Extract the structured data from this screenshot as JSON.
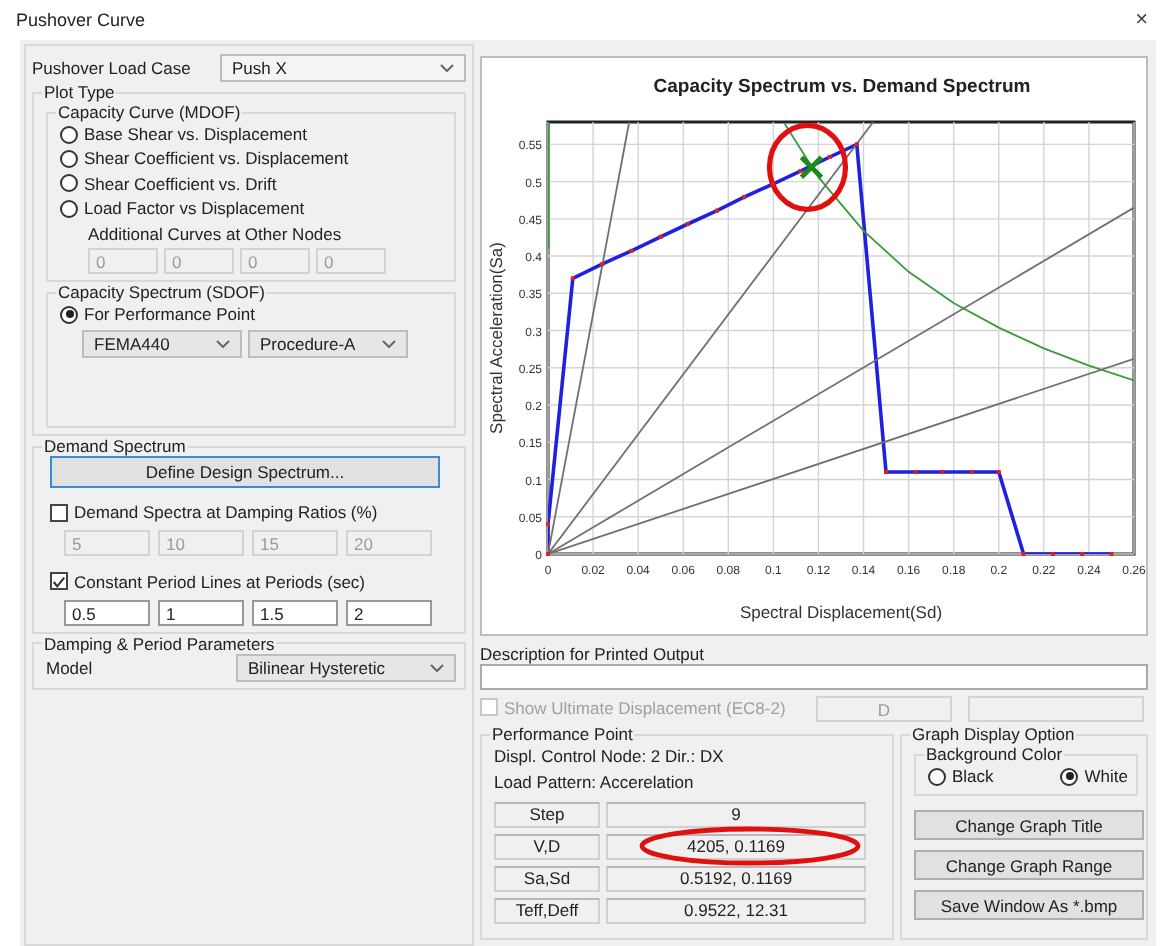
{
  "window": {
    "title": "Pushover Curve",
    "close": "×"
  },
  "load_case": {
    "label": "Pushover Load Case",
    "value": "Push X"
  },
  "plot_type": {
    "title": "Plot Type",
    "capacity_curve": {
      "title": "Capacity Curve (MDOF)",
      "options": [
        {
          "label": "Base Shear vs. Displacement",
          "selected": false
        },
        {
          "label": "Shear Coefficient vs. Displacement",
          "selected": false
        },
        {
          "label": "Shear Coefficient vs. Drift",
          "selected": false
        },
        {
          "label": "Load Factor vs Displacement",
          "selected": false
        }
      ],
      "additional_label": "Additional Curves at Other Nodes",
      "additional_fields": [
        {
          "value": "0",
          "disabled": true
        },
        {
          "value": "0",
          "disabled": true
        },
        {
          "value": "0",
          "disabled": true
        },
        {
          "value": "0",
          "disabled": true
        }
      ]
    },
    "capacity_spectrum": {
      "title": "Capacity Spectrum (SDOF)",
      "options": [
        {
          "label": "For Performance Point",
          "selected": true
        }
      ],
      "method": "FEMA440",
      "procedure": "Procedure-A"
    }
  },
  "demand_spectrum": {
    "title": "Demand Spectrum",
    "button": "Define Design Spectrum...",
    "damping": {
      "label": "Demand Spectra at Damping Ratios (%)",
      "checked": false,
      "fields": [
        {
          "value": "5",
          "disabled": true
        },
        {
          "value": "10",
          "disabled": true
        },
        {
          "value": "15",
          "disabled": true
        },
        {
          "value": "20",
          "disabled": true
        }
      ]
    },
    "periods": {
      "label": "Constant Period Lines at Periods (sec)",
      "checked": true,
      "fields": [
        {
          "value": "0.5",
          "disabled": false
        },
        {
          "value": "1",
          "disabled": false
        },
        {
          "value": "1.5",
          "disabled": false
        },
        {
          "value": "2",
          "disabled": false
        }
      ]
    }
  },
  "damping_parameters": {
    "title": "Damping & Period Parameters",
    "model_label": "Model",
    "model": "Bilinear Hysteretic"
  },
  "chart": {
    "circled": true,
    "chart_data": {
      "type": "line",
      "title": "Capacity Spectrum vs. Demand Spectrum",
      "xlabel": "Spectral Displacement(Sd)",
      "ylabel": "Spectral Acceleration(Sa)",
      "xlim": [
        0,
        0.26
      ],
      "ylim": [
        0,
        0.58
      ],
      "grid": true,
      "xticks": [
        0,
        0.02,
        0.04,
        0.06,
        0.08,
        0.1,
        0.12,
        0.14,
        0.16,
        0.18,
        0.2,
        0.22,
        0.24,
        0.26
      ],
      "yticks": [
        0,
        0.05,
        0.1,
        0.15,
        0.2,
        0.25,
        0.3,
        0.35,
        0.4,
        0.45,
        0.5,
        0.55
      ],
      "series": [
        {
          "color": "#2020e0",
          "marker": "square",
          "x": [
            0,
            0,
            0.011,
            0.024,
            0.037,
            0.05,
            0.062,
            0.075,
            0.087,
            0.1,
            0.112,
            0.125,
            0.137,
            0.15,
            0.163,
            0.175,
            0.188,
            0.2,
            0.211,
            0.224,
            0.237,
            0.25
          ],
          "values": [
            0,
            0.04,
            0.37,
            0.389,
            0.407,
            0.426,
            0.443,
            0.461,
            0.479,
            0.497,
            0.514,
            0.533,
            0.55,
            0.11,
            0.11,
            0.11,
            0.11,
            0.11,
            0,
            0,
            0,
            0
          ]
        },
        {
          "color": "#3c9a3c",
          "x": [
            0.0003,
            0.0003
          ],
          "values": [
            0.41,
            0.58
          ]
        },
        {
          "color": "#3c9a3c",
          "x": [
            0.105,
            0.12,
            0.14,
            0.16,
            0.18,
            0.2,
            0.22,
            0.24,
            0.26
          ],
          "values": [
            0.578,
            0.506,
            0.434,
            0.379,
            0.337,
            0.304,
            0.276,
            0.253,
            0.233
          ]
        },
        {
          "color": "#707070",
          "x": [
            0,
            0.036
          ],
          "values": [
            0,
            0.58
          ]
        },
        {
          "color": "#707070",
          "x": [
            0,
            0.1443
          ],
          "values": [
            0,
            0.58
          ]
        },
        {
          "color": "#707070",
          "x": [
            0,
            0.26
          ],
          "values": [
            0,
            0.465
          ]
        },
        {
          "color": "#707070",
          "x": [
            0,
            0.26
          ],
          "values": [
            0,
            0.262
          ]
        },
        {
          "color": "#1a8a1a",
          "marker": "cross",
          "x": [
            0.1169
          ],
          "values": [
            0.5192
          ]
        }
      ]
    }
  },
  "description": {
    "label": "Description for Printed Output"
  },
  "ultimate": {
    "label": "Show Ultimate Displacement (EC8-2)",
    "checked": false,
    "disabled": true,
    "field": "D"
  },
  "performance_point": {
    "title": "Performance Point",
    "lines": [
      "Displ. Control Node: 2 Dir.: DX",
      "Load Pattern: Accerelation"
    ],
    "rows": [
      {
        "label": "Step",
        "value": "9",
        "highlighted": false
      },
      {
        "label": "V,D",
        "value": "4205,  0.1169",
        "highlighted": true
      },
      {
        "label": "Sa,Sd",
        "value": "0.5192,  0.1169",
        "highlighted": false
      },
      {
        "label": "Teff,Deff",
        "value": "0.9522,  12.31",
        "highlighted": false
      }
    ]
  },
  "graph_display": {
    "title": "Graph Display Option",
    "background": {
      "title": "Background Color",
      "options": [
        {
          "label": "Black",
          "selected": false
        },
        {
          "label": "White",
          "selected": true
        }
      ]
    },
    "buttons": [
      "Change Graph Title",
      "Change Graph Range",
      "Save Window As *.bmp"
    ]
  }
}
